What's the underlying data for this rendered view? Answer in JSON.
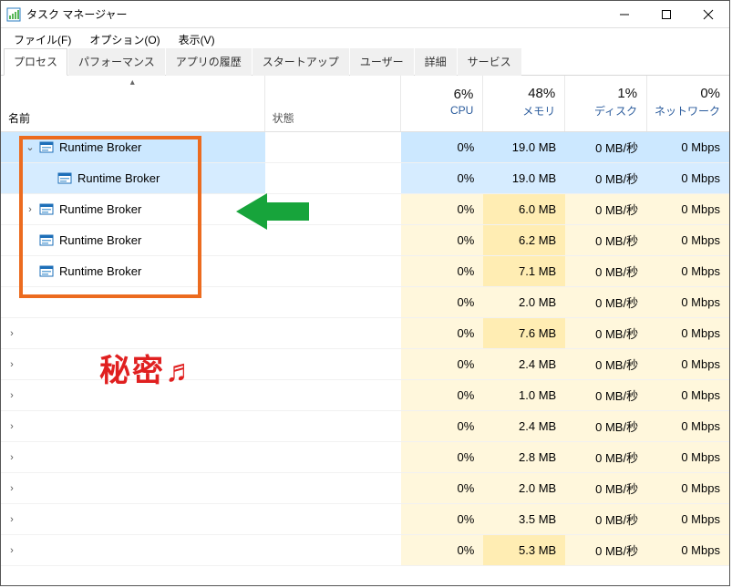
{
  "window": {
    "title": "タスク マネージャー"
  },
  "menu": {
    "file": "ファイル(F)",
    "options": "オプション(O)",
    "view": "表示(V)"
  },
  "tabs": {
    "processes": "プロセス",
    "performance": "パフォーマンス",
    "app_history": "アプリの履歴",
    "startup": "スタートアップ",
    "users": "ユーザー",
    "details": "詳細",
    "services": "サービス"
  },
  "columns": {
    "name": "名前",
    "status": "状態",
    "cpu_pct": "6%",
    "cpu_label": "CPU",
    "mem_pct": "48%",
    "mem_label": "メモリ",
    "disk_pct": "1%",
    "disk_label": "ディスク",
    "net_pct": "0%",
    "net_label": "ネットワーク"
  },
  "rows": [
    {
      "expand": "v",
      "indent": 1,
      "icon": true,
      "name": "Runtime Broker",
      "cpu": "0%",
      "mem": "19.0 MB",
      "disk": "0 MB/秒",
      "net": "0 Mbps",
      "sel": "selected"
    },
    {
      "expand": "",
      "indent": 2,
      "icon": true,
      "name": "Runtime Broker",
      "cpu": "0%",
      "mem": "19.0 MB",
      "disk": "0 MB/秒",
      "net": "0 Mbps",
      "sel": "child-sel"
    },
    {
      "expand": ">",
      "indent": 1,
      "icon": true,
      "name": "Runtime Broker",
      "cpu": "0%",
      "mem": "6.0 MB",
      "disk": "0 MB/秒",
      "net": "0 Mbps",
      "sel": ""
    },
    {
      "expand": "",
      "indent": 1,
      "icon": true,
      "name": "Runtime Broker",
      "cpu": "0%",
      "mem": "6.2 MB",
      "disk": "0 MB/秒",
      "net": "0 Mbps",
      "sel": ""
    },
    {
      "expand": "",
      "indent": 1,
      "icon": true,
      "name": "Runtime Broker",
      "cpu": "0%",
      "mem": "7.1 MB",
      "disk": "0 MB/秒",
      "net": "0 Mbps",
      "sel": ""
    },
    {
      "expand": "",
      "indent": 0,
      "icon": false,
      "name": "",
      "cpu": "0%",
      "mem": "2.0 MB",
      "disk": "0 MB/秒",
      "net": "0 Mbps",
      "sel": ""
    },
    {
      "expand": ">",
      "indent": 0,
      "icon": false,
      "name": "",
      "cpu": "0%",
      "mem": "7.6 MB",
      "disk": "0 MB/秒",
      "net": "0 Mbps",
      "sel": ""
    },
    {
      "expand": ">",
      "indent": 0,
      "icon": false,
      "name": "",
      "cpu": "0%",
      "mem": "2.4 MB",
      "disk": "0 MB/秒",
      "net": "0 Mbps",
      "sel": ""
    },
    {
      "expand": ">",
      "indent": 0,
      "icon": false,
      "name": "",
      "cpu": "0%",
      "mem": "1.0 MB",
      "disk": "0 MB/秒",
      "net": "0 Mbps",
      "sel": ""
    },
    {
      "expand": ">",
      "indent": 0,
      "icon": false,
      "name": "",
      "cpu": "0%",
      "mem": "2.4 MB",
      "disk": "0 MB/秒",
      "net": "0 Mbps",
      "sel": ""
    },
    {
      "expand": ">",
      "indent": 0,
      "icon": false,
      "name": "",
      "cpu": "0%",
      "mem": "2.8 MB",
      "disk": "0 MB/秒",
      "net": "0 Mbps",
      "sel": ""
    },
    {
      "expand": ">",
      "indent": 0,
      "icon": false,
      "name": "",
      "cpu": "0%",
      "mem": "2.0 MB",
      "disk": "0 MB/秒",
      "net": "0 Mbps",
      "sel": ""
    },
    {
      "expand": ">",
      "indent": 0,
      "icon": false,
      "name": "",
      "cpu": "0%",
      "mem": "3.5 MB",
      "disk": "0 MB/秒",
      "net": "0 Mbps",
      "sel": ""
    },
    {
      "expand": ">",
      "indent": 0,
      "icon": false,
      "name": "",
      "cpu": "0%",
      "mem": "5.3 MB",
      "disk": "0 MB/秒",
      "net": "0 Mbps",
      "sel": ""
    }
  ],
  "annotation": {
    "text": "秘密♬"
  }
}
